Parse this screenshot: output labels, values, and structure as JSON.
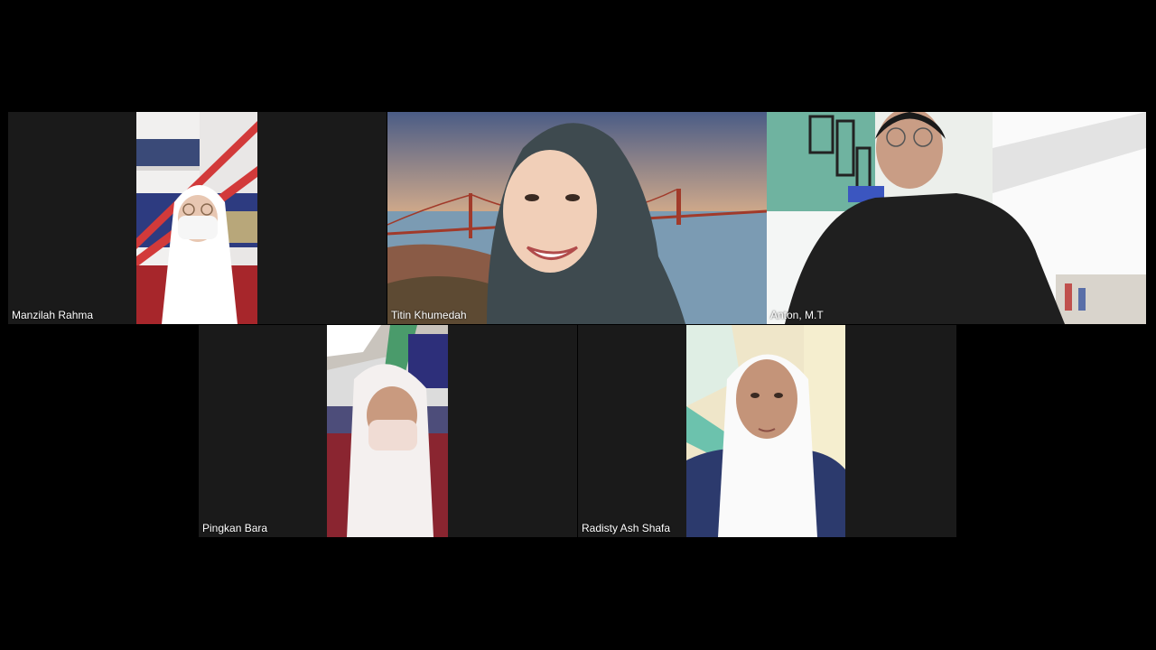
{
  "participants": [
    {
      "name": "Manzilah Rahma"
    },
    {
      "name": "Titin Khumedah"
    },
    {
      "name": "Anton, M.T"
    },
    {
      "name": "Pingkan Bara"
    },
    {
      "name": "Radisty Ash Shafa"
    }
  ],
  "colors": {
    "background": "#000000",
    "tile": "#1a1a1a",
    "name_text": "#ffffff"
  }
}
